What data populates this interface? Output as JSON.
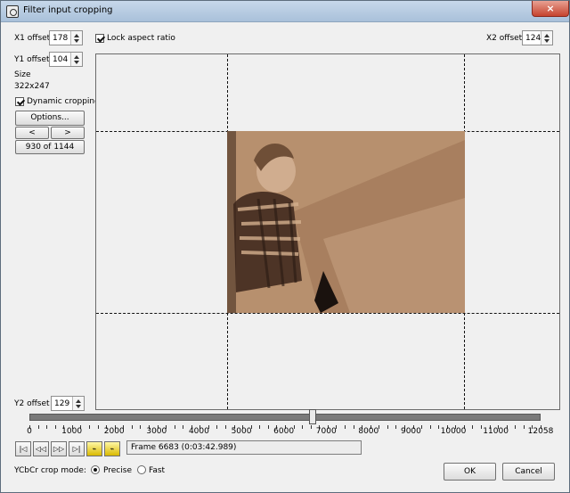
{
  "window": {
    "title": "Filter input cropping",
    "close_glyph": "×"
  },
  "crop": {
    "x1_label": "X1 offset",
    "x1_value": "178",
    "y1_label": "Y1 offset",
    "y1_value": "104",
    "x2_label": "X2 offset",
    "x2_value": "124",
    "y2_label": "Y2 offset",
    "y2_value": "129",
    "size_label": "Size",
    "size_value": "322x247",
    "lock_aspect_label": "Lock aspect ratio",
    "dynamic_cropping_label": "Dynamic cropping"
  },
  "controls": {
    "options_label": "Options...",
    "prev_label": "<",
    "next_label": ">",
    "position_text": "930 of 1144"
  },
  "timeline": {
    "min": 0,
    "max": 12058,
    "current_frame": 6683,
    "tick_labels": [
      "0",
      "1000",
      "2000",
      "3000",
      "4000",
      "5000",
      "6000",
      "7000",
      "8000",
      "9000",
      "10000",
      "11000",
      "12058"
    ],
    "frame_text": "Frame 6683 (0:03:42.989)"
  },
  "navigation": {
    "buttons": [
      {
        "name": "go-start-icon",
        "glyph": "|◁"
      },
      {
        "name": "step-back-icon",
        "glyph": "◁◁"
      },
      {
        "name": "step-forward-icon",
        "glyph": "▷▷"
      },
      {
        "name": "go-end-icon",
        "glyph": "▷|"
      },
      {
        "name": "key-prev-icon",
        "glyph": "⌁"
      },
      {
        "name": "key-next-icon",
        "glyph": "⌁"
      }
    ]
  },
  "bottom": {
    "mode_label": "YCbCr crop mode:",
    "precise_label": "Precise",
    "fast_label": "Fast",
    "ok_label": "OK",
    "cancel_label": "Cancel"
  },
  "colors": {
    "video_sepia": "#b7906e",
    "slider_track": "#7a7a7a",
    "close_button": "#c6432e"
  }
}
